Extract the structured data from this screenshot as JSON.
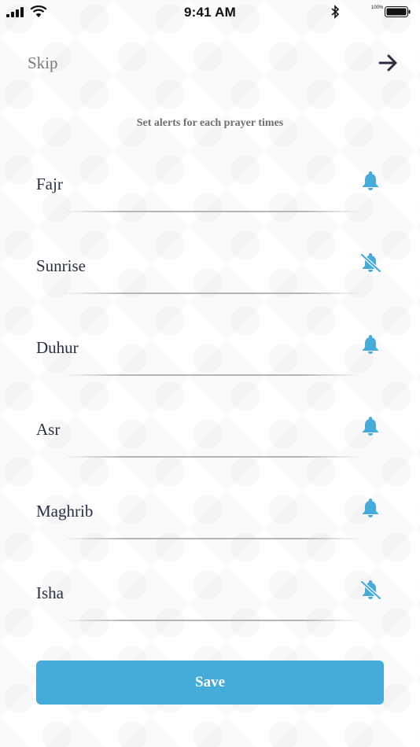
{
  "status_bar": {
    "time": "9:41 AM",
    "battery_percent": "100%",
    "icons": [
      "signal-icon",
      "wifi-icon",
      "bluetooth-icon",
      "battery-icon"
    ]
  },
  "nav": {
    "skip_label": "Skip",
    "next_icon": "arrow-right-icon"
  },
  "subtitle": "Set alerts for each prayer times",
  "prayers": [
    {
      "name": "Fajr",
      "alert": "on"
    },
    {
      "name": "Sunrise",
      "alert": "off"
    },
    {
      "name": "Duhur",
      "alert": "on"
    },
    {
      "name": "Asr",
      "alert": "on"
    },
    {
      "name": "Maghrib",
      "alert": "on"
    },
    {
      "name": "Isha",
      "alert": "off"
    }
  ],
  "save_label": "Save",
  "colors": {
    "accent": "#45abd8",
    "label": "#2a2f45",
    "muted": "#7a7a7a",
    "arrow": "#2a2f45"
  }
}
